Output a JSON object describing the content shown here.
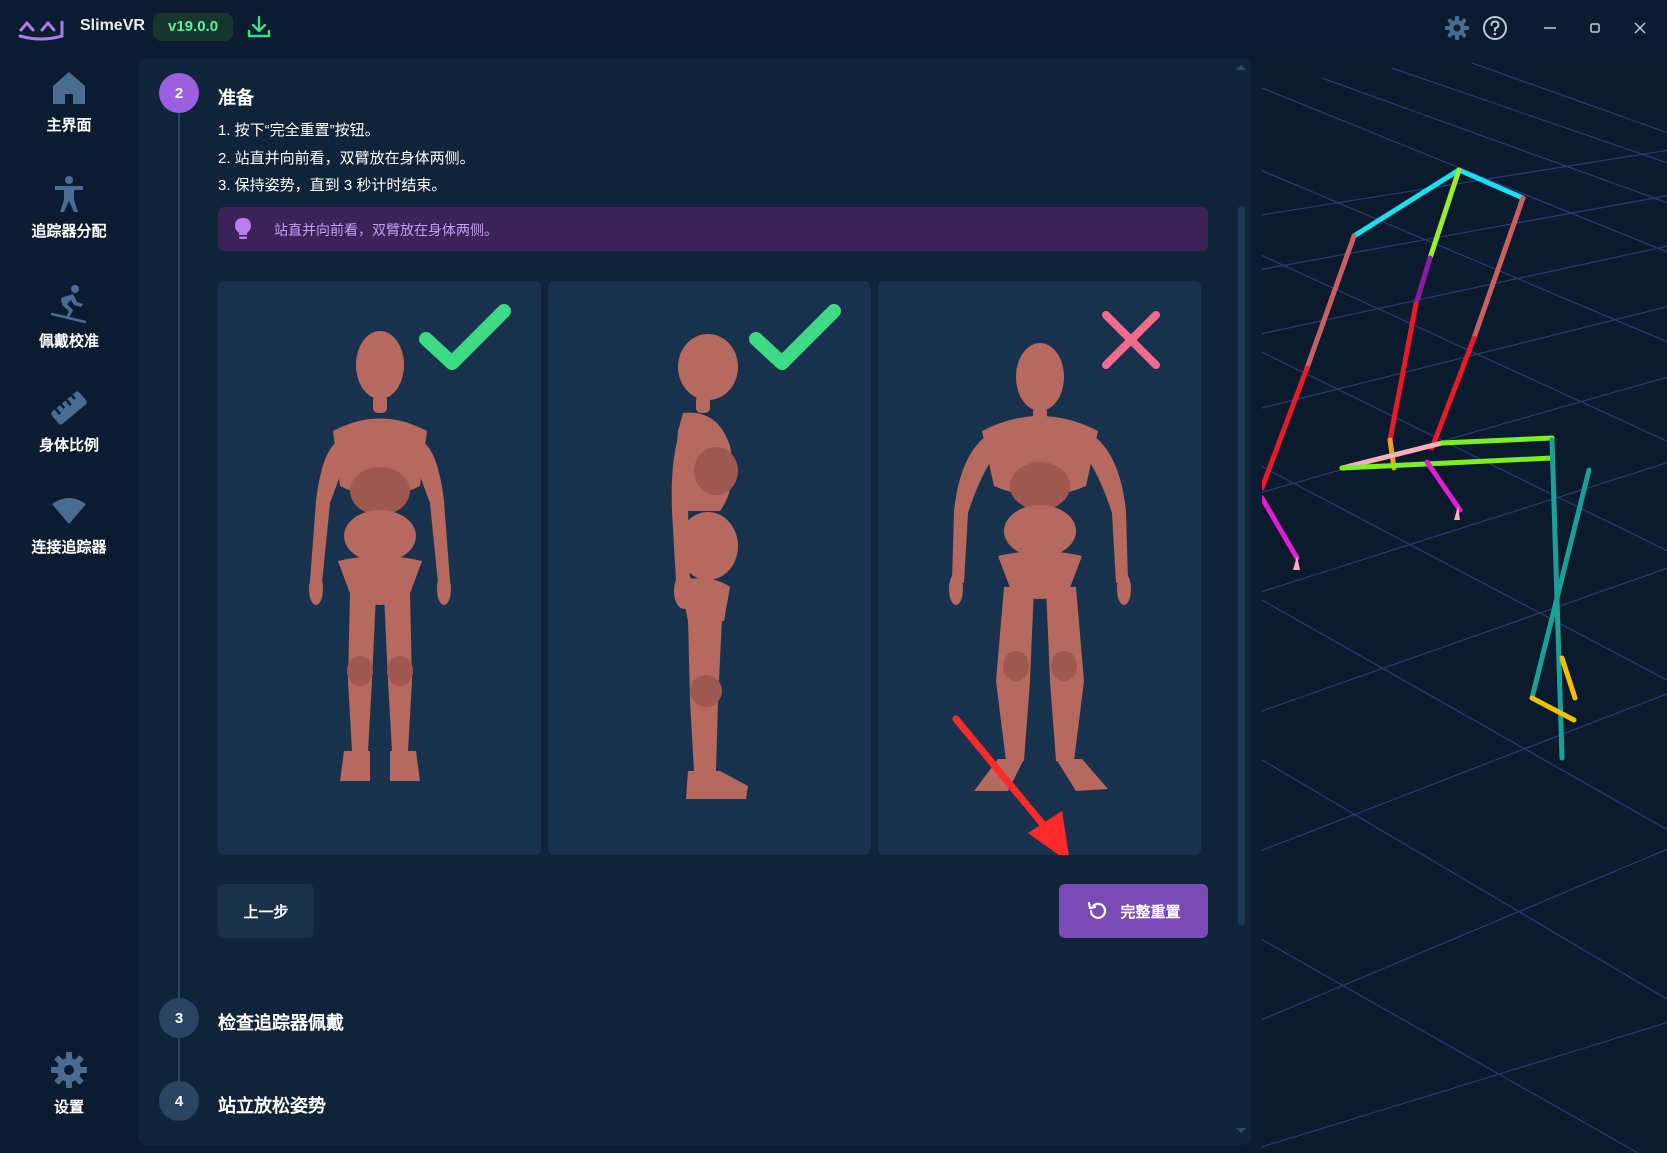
{
  "app": {
    "title": "SlimeVR",
    "version": "v19.0.0"
  },
  "sidebar": {
    "items": [
      {
        "label": "主界面",
        "icon": "home-icon"
      },
      {
        "label": "追踪器分配",
        "icon": "person-assign-icon"
      },
      {
        "label": "佩戴校准",
        "icon": "skier-icon"
      },
      {
        "label": "身体比例",
        "icon": "ruler-icon"
      },
      {
        "label": "连接追踪器",
        "icon": "wifi-icon"
      }
    ],
    "settings_label": "设置"
  },
  "steps": [
    {
      "number": "2",
      "title": "准备"
    },
    {
      "number": "3",
      "title": "检查追踪器佩戴"
    },
    {
      "number": "4",
      "title": "站立放松姿势"
    }
  ],
  "instructions": [
    "1. 按下“完全重置”按钮。",
    "2. 站直并向前看，双臂放在身体两侧。",
    "3. 保持姿势，直到 3 秒计时结束。"
  ],
  "tip": "站直并向前看，双臂放在身体两侧。",
  "poses": [
    {
      "status": "correct",
      "icon": "check-icon",
      "view": "front"
    },
    {
      "status": "correct",
      "icon": "check-icon",
      "view": "side"
    },
    {
      "status": "wrong",
      "icon": "cross-icon",
      "view": "front-hunched"
    }
  ],
  "buttons": {
    "back": "上一步",
    "reset": "完整重置"
  },
  "colors": {
    "accent": "#7a4bb5",
    "success": "#3ddc84",
    "error": "#f06b8c",
    "figure": "#b5695f"
  }
}
